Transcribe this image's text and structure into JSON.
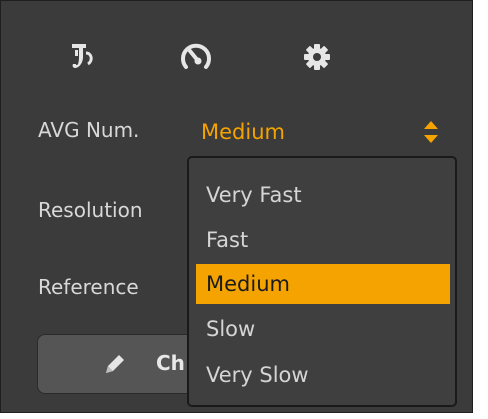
{
  "toolbar": {
    "icons": [
      "probe-icon",
      "gauge-icon",
      "gear-icon"
    ]
  },
  "fields": {
    "avg_label": "AVG Num.",
    "avg_value": "Medium",
    "resolution_label": "Resolution",
    "reference_label": "Reference"
  },
  "dropdown": {
    "options": [
      "Very Fast",
      "Fast",
      "Medium",
      "Slow",
      "Very Slow"
    ],
    "selected": "Medium"
  },
  "action_button": {
    "label": "Ch"
  },
  "colors": {
    "accent": "#f5a300",
    "panel": "#3b3b3b",
    "text": "#d8d8d8"
  }
}
